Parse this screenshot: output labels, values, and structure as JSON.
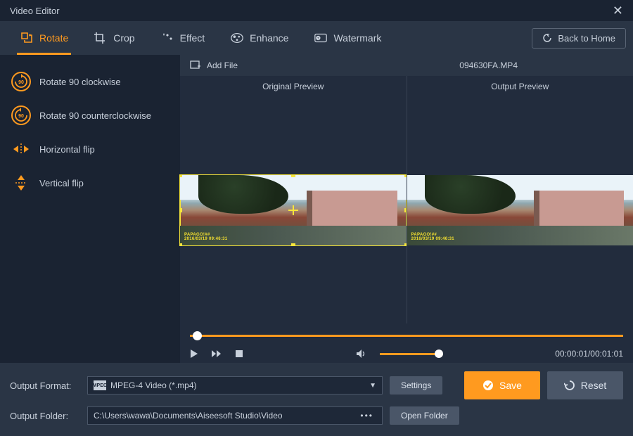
{
  "title": "Video Editor",
  "tabs": [
    {
      "label": "Rotate"
    },
    {
      "label": "Crop"
    },
    {
      "label": "Effect"
    },
    {
      "label": "Enhance"
    },
    {
      "label": "Watermark"
    }
  ],
  "back_label": "Back to Home",
  "sidebar": {
    "items": [
      {
        "label": "Rotate 90 clockwise"
      },
      {
        "label": "Rotate 90 counterclockwise"
      },
      {
        "label": "Horizontal flip"
      },
      {
        "label": "Vertical flip"
      }
    ]
  },
  "file_bar": {
    "add_label": "Add File",
    "current_file": "094630FA.MP4"
  },
  "preview": {
    "original_label": "Original Preview",
    "output_label": "Output Preview",
    "stamp1": "PAPAGO!##",
    "stamp2": "2016/03/19 09:46:31"
  },
  "playback": {
    "time": "00:00:01/00:01:01"
  },
  "output": {
    "format_label": "Output Format:",
    "format_value": "MPEG-4 Video (*.mp4)",
    "format_badge": "MPEG",
    "settings_label": "Settings",
    "folder_label": "Output Folder:",
    "folder_value": "C:\\Users\\wawa\\Documents\\Aiseesoft Studio\\Video",
    "open_folder_label": "Open Folder"
  },
  "actions": {
    "save": "Save",
    "reset": "Reset"
  }
}
